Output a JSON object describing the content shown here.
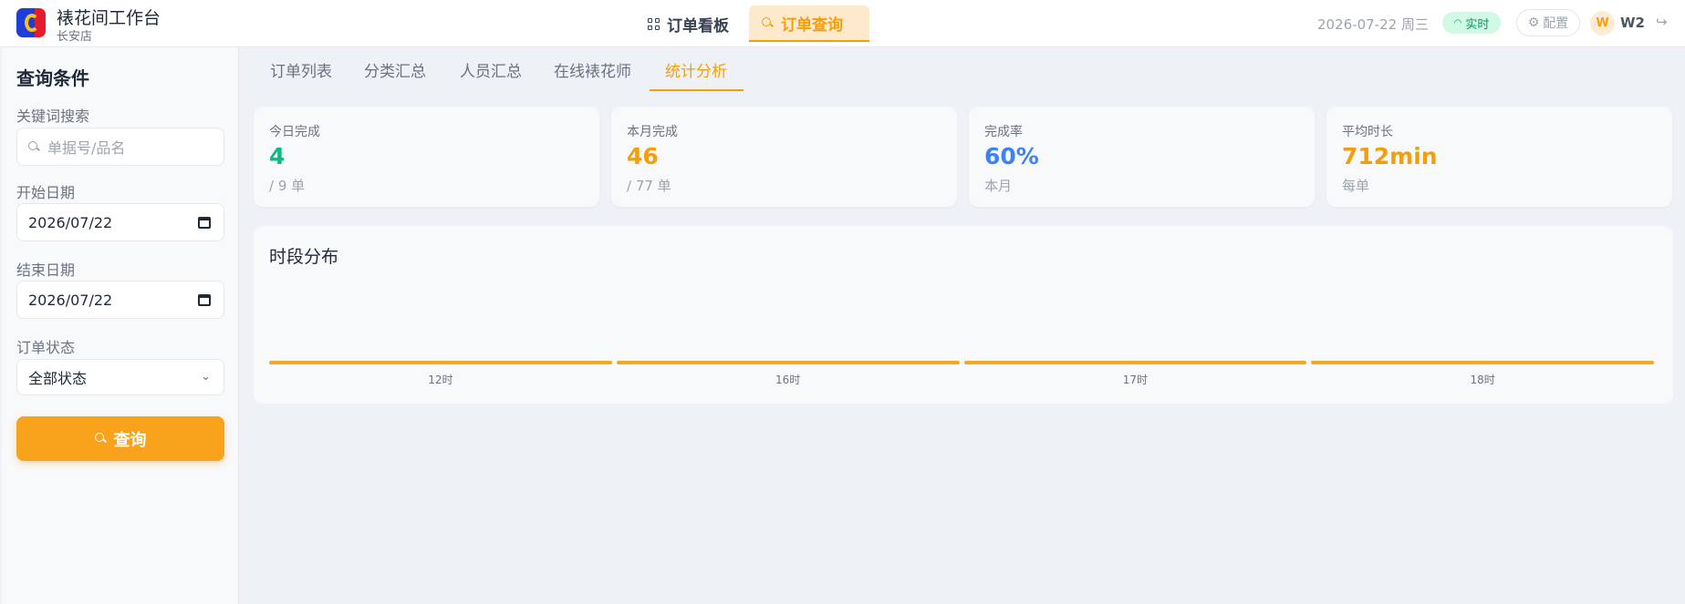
{
  "header": {
    "app_title": "裱花间工作台",
    "store_name": "长安店",
    "nav_tabs": [
      {
        "label": "订单看板",
        "icon": "grid-icon",
        "active": false
      },
      {
        "label": "订单查询",
        "icon": "search-icon",
        "active": true
      }
    ],
    "date": "2026-07-22 周三",
    "live_status": "实时",
    "config_label": "配置",
    "avatar_letter": "W",
    "user_name": "W2",
    "accent_color": "#f59e0b"
  },
  "sidebar": {
    "title": "查询条件",
    "keyword": {
      "label": "关键词搜索",
      "placeholder": "单据号/品名",
      "value": ""
    },
    "start_date": {
      "label": "开始日期",
      "value": "2026/07/22"
    },
    "end_date": {
      "label": "结束日期",
      "value": "2026/07/22"
    },
    "status": {
      "label": "订单状态",
      "selected": "全部状态"
    },
    "query_button": "查询"
  },
  "subtabs": [
    {
      "label": "订单列表",
      "active": false
    },
    {
      "label": "分类汇总",
      "active": false
    },
    {
      "label": "人员汇总",
      "active": false
    },
    {
      "label": "在线裱花师",
      "active": false
    },
    {
      "label": "统计分析",
      "active": true
    }
  ],
  "stats": [
    {
      "label": "今日完成",
      "value": "4",
      "sub": "/ 9 单",
      "color": "#10b981"
    },
    {
      "label": "本月完成",
      "value": "46",
      "sub": "/ 77 单",
      "color": "#f59e0b"
    },
    {
      "label": "完成率",
      "value": "60%",
      "sub": "本月",
      "color": "#3b82f6"
    },
    {
      "label": "平均时长",
      "value": "712min",
      "sub": "每单",
      "color": "#f59e0b"
    }
  ],
  "chart_data": {
    "type": "bar",
    "title": "时段分布",
    "categories": [
      "12时",
      "16时",
      "17时",
      "18时"
    ],
    "values": [
      1,
      1,
      1,
      1
    ],
    "color": "#f5a623"
  }
}
